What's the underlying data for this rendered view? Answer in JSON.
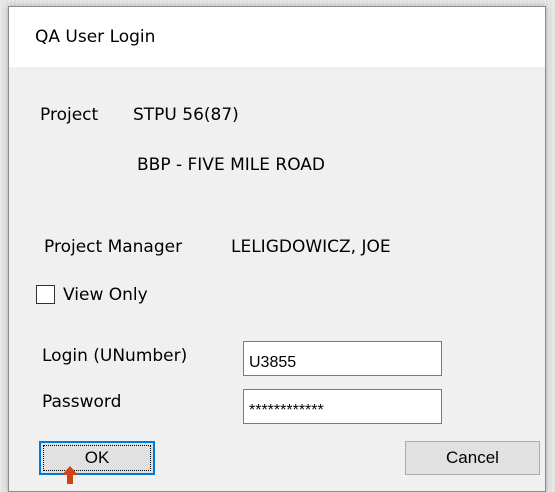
{
  "window": {
    "title": "QA User Login"
  },
  "project": {
    "label": "Project",
    "number": "STPU 56(87)",
    "name": "BBP - FIVE MILE ROAD"
  },
  "manager": {
    "label": "Project Manager",
    "name": "LELIGDOWICZ, JOE"
  },
  "view_only": {
    "label": "View Only",
    "checked": false
  },
  "login": {
    "label": "Login (UNumber)",
    "value": "U3855"
  },
  "password": {
    "label": "Password",
    "value": "************"
  },
  "buttons": {
    "ok_label": "OK",
    "cancel_label": "Cancel"
  },
  "colors": {
    "default_button_border": "#0078d7",
    "cursor_arrow": "#d0441c"
  },
  "icons": {
    "cursor": "arrow-pointer-icon"
  }
}
